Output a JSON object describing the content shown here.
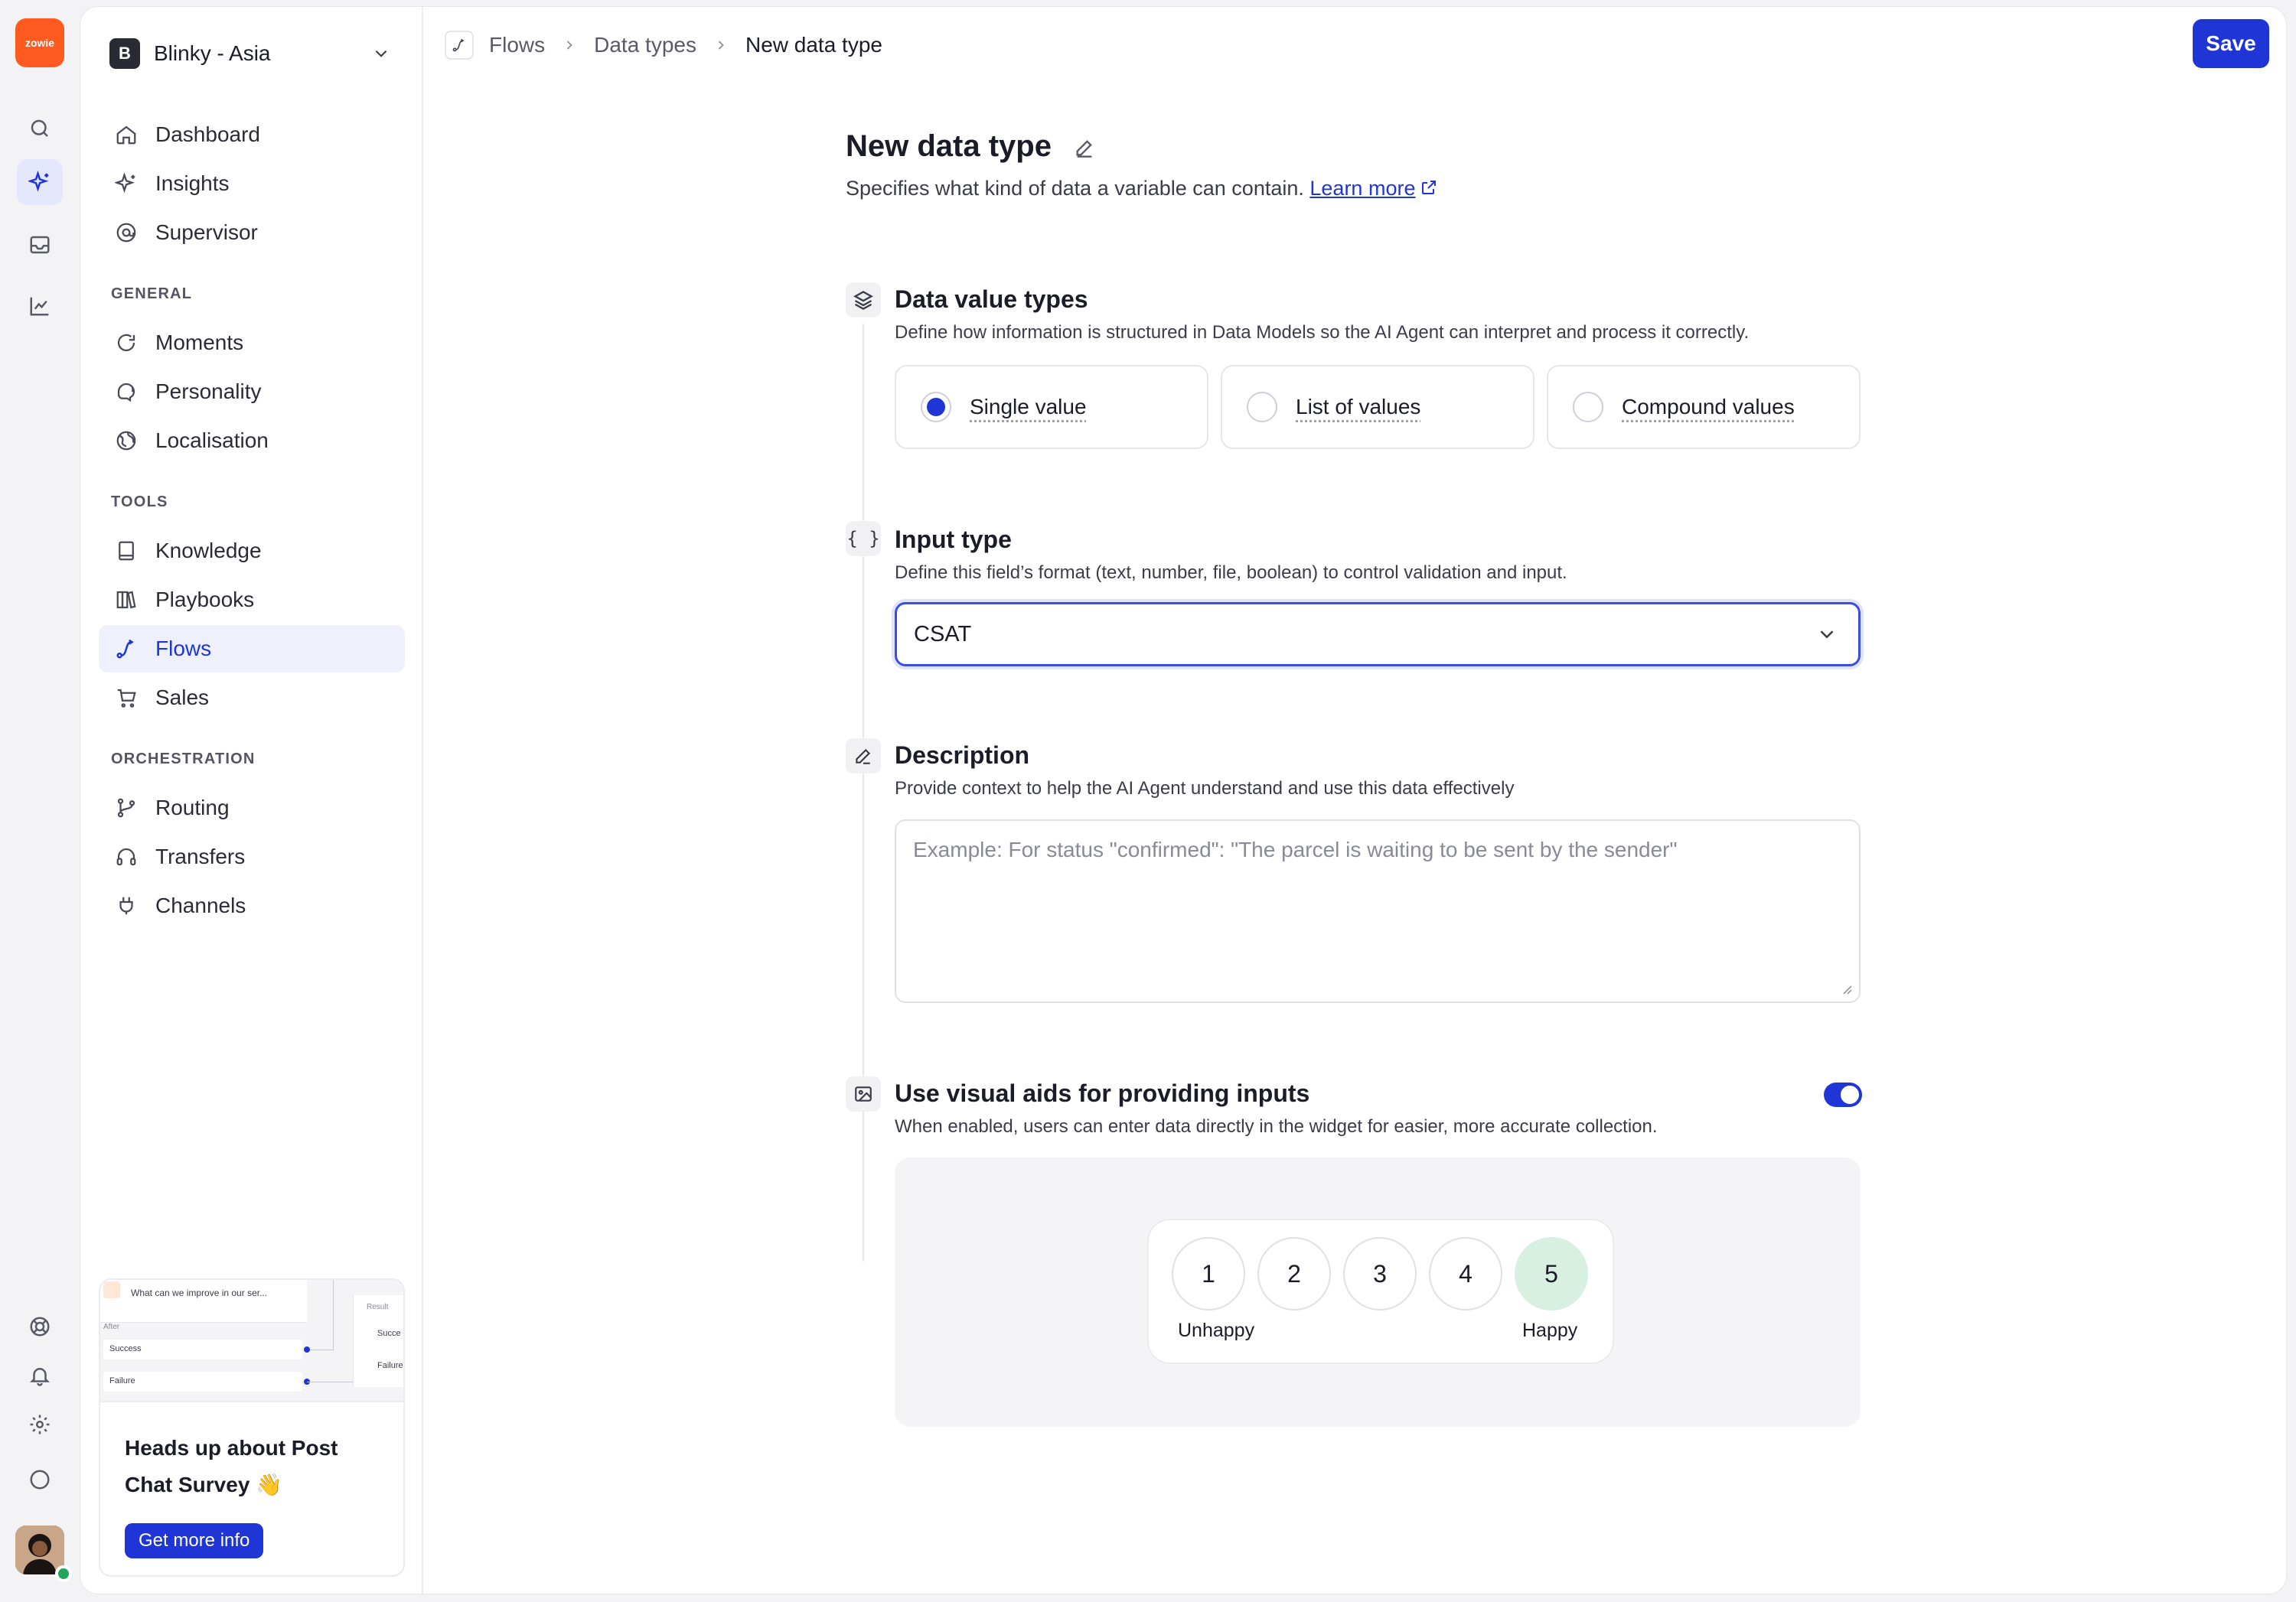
{
  "app": {
    "logo_text": "zowie"
  },
  "workspace": {
    "badge": "B",
    "name": "Blinky - Asia"
  },
  "rail": {
    "icons": [
      "search-icon",
      "sparkle-icon",
      "inbox-icon",
      "chart-icon"
    ],
    "bottom_icons": [
      "help-icon",
      "bell-icon",
      "gear-icon",
      "chat-icon"
    ]
  },
  "sidebar": {
    "top_items": [
      {
        "label": "Dashboard",
        "icon": "home-icon"
      },
      {
        "label": "Insights",
        "icon": "sparkle-icon"
      },
      {
        "label": "Supervisor",
        "icon": "at-icon"
      }
    ],
    "sections": [
      {
        "title": "GENERAL",
        "items": [
          {
            "label": "Moments",
            "icon": "refresh-icon"
          },
          {
            "label": "Personality",
            "icon": "speech-icon"
          },
          {
            "label": "Localisation",
            "icon": "globe-icon"
          }
        ]
      },
      {
        "title": "TOOLS",
        "items": [
          {
            "label": "Knowledge",
            "icon": "book-icon"
          },
          {
            "label": "Playbooks",
            "icon": "library-icon"
          },
          {
            "label": "Flows",
            "icon": "flow-icon",
            "active": true
          },
          {
            "label": "Sales",
            "icon": "cart-icon"
          }
        ]
      },
      {
        "title": "ORCHESTRATION",
        "items": [
          {
            "label": "Routing",
            "icon": "branch-icon"
          },
          {
            "label": "Transfers",
            "icon": "headset-icon"
          },
          {
            "label": "Channels",
            "icon": "plug-icon"
          }
        ]
      }
    ],
    "promo": {
      "title": "Heads up about Post Chat Survey 👋",
      "button": "Get more info",
      "thumb": {
        "question": "What can we improve in our ser...",
        "after": "After",
        "success": "Success",
        "failure": "Failure",
        "result": "Result",
        "r_success": "Succe",
        "r_failure": "Failure"
      }
    }
  },
  "breadcrumb": [
    "Flows",
    "Data types",
    "New data type"
  ],
  "toolbar": {
    "save_label": "Save"
  },
  "page": {
    "title": "New data type",
    "subtitle": "Specifies what kind of data a variable can contain.",
    "learn_more": "Learn more"
  },
  "data_value_types": {
    "title": "Data value types",
    "desc": "Define how information is structured in Data Models so the AI Agent can interpret and process it correctly.",
    "options": [
      {
        "label": "Single value",
        "selected": true
      },
      {
        "label": "List of values",
        "selected": false
      },
      {
        "label": "Compound values",
        "selected": false
      }
    ]
  },
  "input_type": {
    "title": "Input type",
    "desc": "Define this field’s format (text, number, file, boolean) to control validation and input.",
    "value": "CSAT"
  },
  "description": {
    "title": "Description",
    "desc": "Provide context to help the AI Agent understand and use this data effectively",
    "placeholder": "Example: For status \"confirmed\": \"The parcel is waiting to be sent by the sender\""
  },
  "visual_aids": {
    "title": "Use visual aids for providing inputs",
    "desc": "When enabled, users can enter data directly in the widget for easier, more accurate collection.",
    "enabled": true,
    "rating": {
      "options": [
        "1",
        "2",
        "3",
        "4",
        "5"
      ],
      "selected": "5",
      "low_label": "Unhappy",
      "high_label": "Happy"
    }
  },
  "colors": {
    "accent": "#1f35d6",
    "brand": "#ff5a1f",
    "selected_rating": "#d8f0e2"
  }
}
